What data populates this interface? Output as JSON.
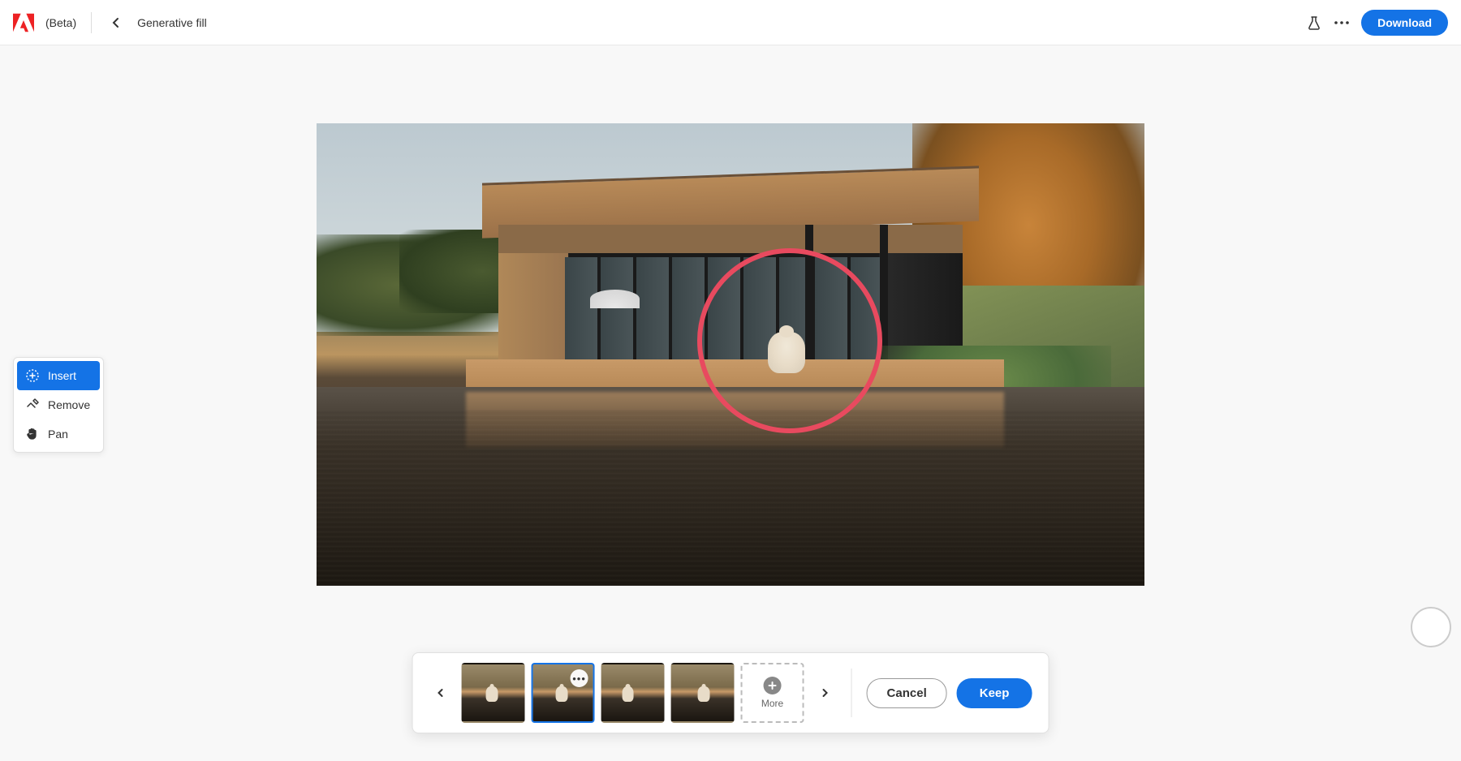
{
  "header": {
    "beta_label": "(Beta)",
    "page_title": "Generative fill",
    "download_label": "Download"
  },
  "tools": {
    "insert_label": "Insert",
    "remove_label": "Remove",
    "pan_label": "Pan",
    "active": "insert"
  },
  "variations": {
    "more_label": "More",
    "selected_index": 1,
    "count": 4
  },
  "actions": {
    "cancel_label": "Cancel",
    "keep_label": "Keep"
  }
}
